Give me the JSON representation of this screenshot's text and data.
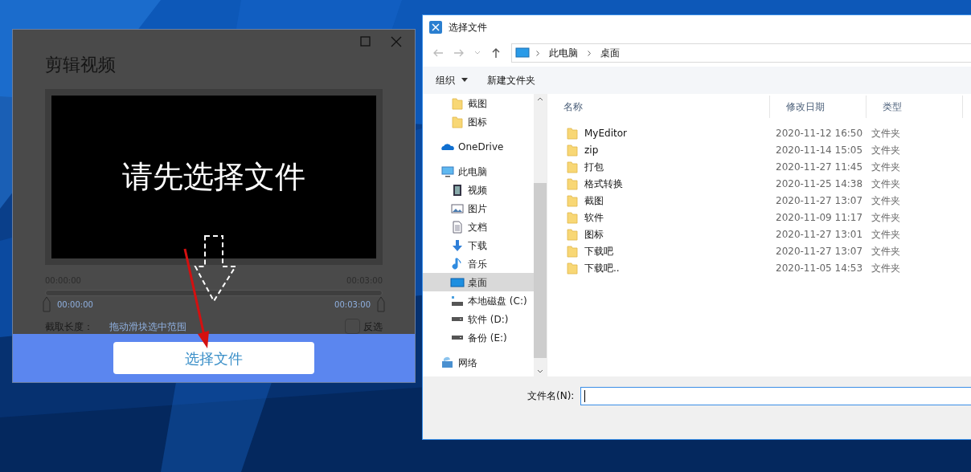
{
  "editor_window": {
    "title": "剪辑视频",
    "preview_message": "请先选择文件",
    "timeline": {
      "start": "00:00:00",
      "end": "00:03:00",
      "start_handle": "00:00:00",
      "end_handle": "00:03:00"
    },
    "clip_length_label": "截取长度：",
    "clip_length_hint": "拖动滑块选中范围",
    "invert": {
      "label": "反选",
      "checked": false
    },
    "select_button": "选择文件"
  },
  "file_dialog": {
    "title": "选择文件",
    "breadcrumb": [
      "此电脑",
      "桌面"
    ],
    "toolbar": {
      "organize": "组织",
      "new_folder": "新建文件夹"
    },
    "nav_pane": {
      "quick_access_items": [
        {
          "label": "截图",
          "kind": "folder",
          "selected": false
        },
        {
          "label": "图标",
          "kind": "folder",
          "selected": false
        }
      ],
      "tree": [
        {
          "label": "OneDrive",
          "kind": "cloud",
          "selected": false
        },
        {
          "label": "此电脑",
          "kind": "pc",
          "selected": false,
          "children": [
            {
              "label": "视频",
              "kind": "video",
              "selected": false
            },
            {
              "label": "图片",
              "kind": "picture",
              "selected": false
            },
            {
              "label": "文档",
              "kind": "document",
              "selected": false
            },
            {
              "label": "下载",
              "kind": "download",
              "selected": false
            },
            {
              "label": "音乐",
              "kind": "music",
              "selected": false
            },
            {
              "label": "桌面",
              "kind": "desktop",
              "selected": true
            },
            {
              "label": "本地磁盘 (C:)",
              "kind": "system-drive",
              "selected": false
            },
            {
              "label": "软件 (D:)",
              "kind": "drive",
              "selected": false
            },
            {
              "label": "备份 (E:)",
              "kind": "drive",
              "selected": false
            }
          ]
        },
        {
          "label": "网络",
          "kind": "network",
          "selected": false
        }
      ]
    },
    "columns": [
      "名称",
      "修改日期",
      "类型"
    ],
    "rows": [
      {
        "name": "MyEditor",
        "modified": "2020-11-12 16:50",
        "type": "文件夹"
      },
      {
        "name": "zip",
        "modified": "2020-11-14 15:05",
        "type": "文件夹"
      },
      {
        "name": "打包",
        "modified": "2020-11-27 11:45",
        "type": "文件夹"
      },
      {
        "name": "格式转换",
        "modified": "2020-11-25 14:38",
        "type": "文件夹"
      },
      {
        "name": "截图",
        "modified": "2020-11-27 13:07",
        "type": "文件夹"
      },
      {
        "name": "软件",
        "modified": "2020-11-09 11:17",
        "type": "文件夹"
      },
      {
        "name": "图标",
        "modified": "2020-11-27 13:01",
        "type": "文件夹"
      },
      {
        "name": "下载吧",
        "modified": "2020-11-27 13:07",
        "type": "文件夹"
      },
      {
        "name": "下载吧..",
        "modified": "2020-11-05 14:53",
        "type": "文件夹"
      }
    ],
    "file_name_label": "文件名(N):"
  }
}
